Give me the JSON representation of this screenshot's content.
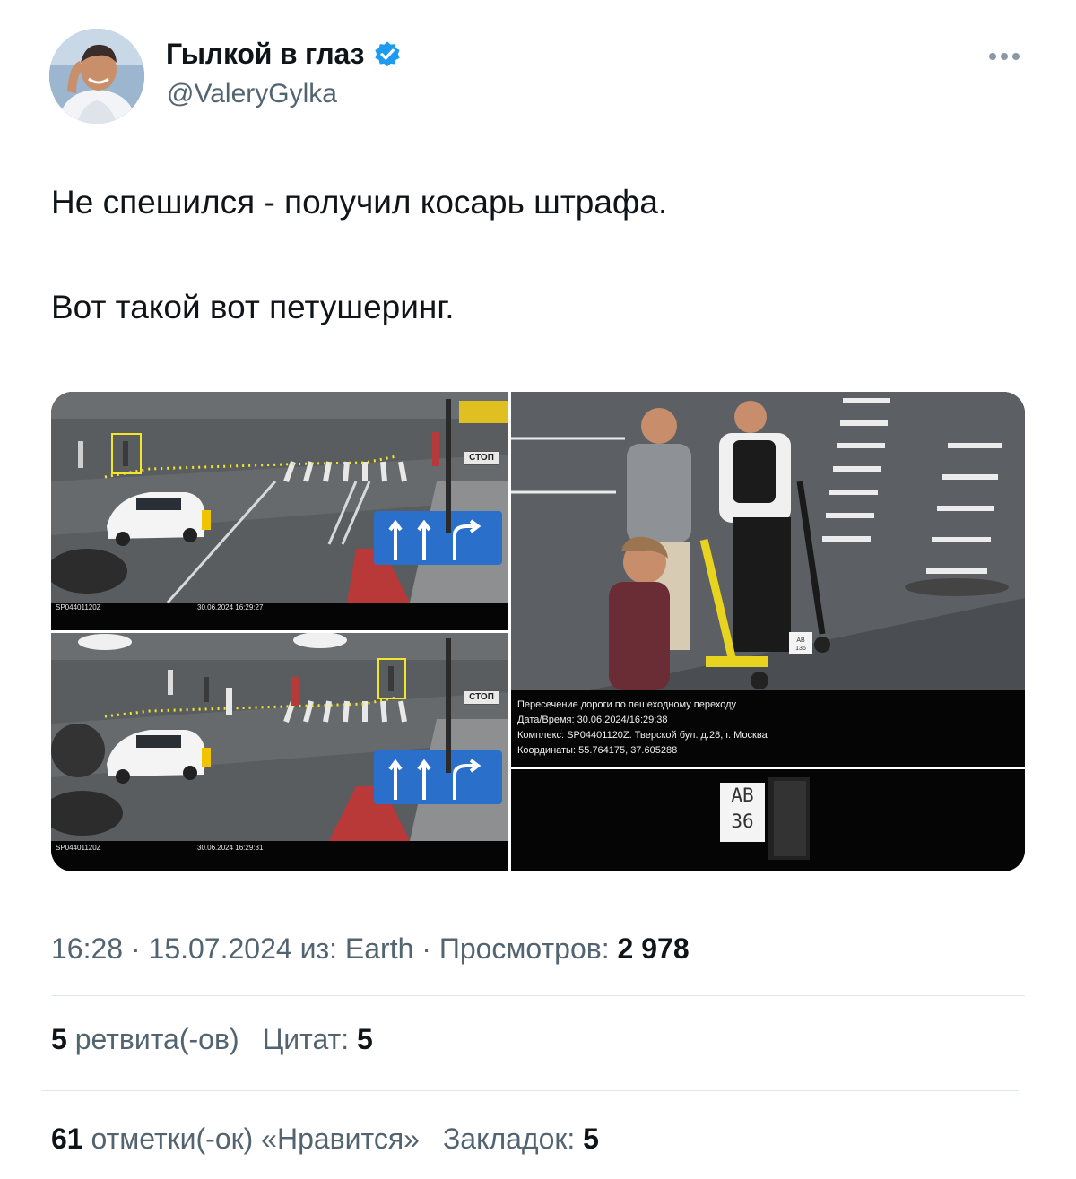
{
  "author": {
    "display_name": "Гылкой в глаз",
    "handle": "@ValeryGylka",
    "verified": true,
    "avatar_icon": "avatar-photo",
    "verified_color": "#1d9bf0"
  },
  "tweet": {
    "line1": "Не спешился - получил косарь штрафа.",
    "line2": "Вот такой вот петушеринг."
  },
  "media": {
    "frame1": {
      "camera_id": "SP04401120Z",
      "timestamp": "30.06.2024 16:29:27",
      "stop_sign": "СТОП"
    },
    "frame2": {
      "camera_id": "SP04401120Z",
      "timestamp": "30.06.2024 16:29:31",
      "stop_sign": "СТОП"
    },
    "violation_info": [
      "Пересечение дороги по пешеходному переходу",
      "Дата/Время: 30.06.2024/16:29:38",
      "Комплекс: SP04401120Z. Тверской бул. д.28, г. Москва",
      "Координаты: 55.764175, 37.605288"
    ],
    "plate": "АВ\n36",
    "small_plate": "АВ\n136"
  },
  "meta": {
    "time": "16:28",
    "sep1": " · ",
    "date": "15.07.2024",
    "from_label": " из: ",
    "source": "Earth",
    "sep2": " · ",
    "views_label": "Просмотров: ",
    "views_value": "2 978"
  },
  "stats": {
    "retweets_value": "5",
    "retweets_label": " ретвита(-ов)",
    "quotes_label": "Цитат: ",
    "quotes_value": "5",
    "likes_value": "61",
    "likes_label": " отметки(-ок) «Нравится»",
    "bookmarks_label": "Закладок: ",
    "bookmarks_value": "5"
  }
}
